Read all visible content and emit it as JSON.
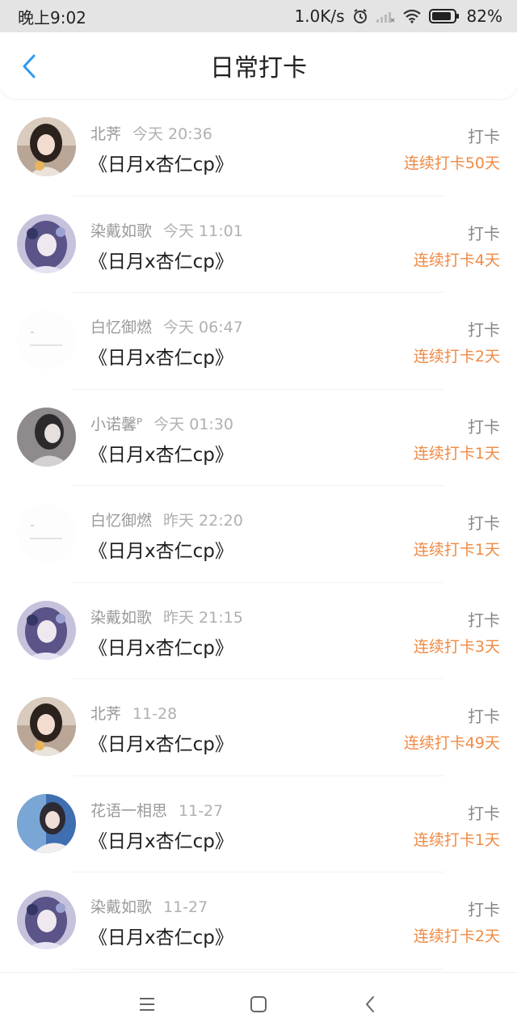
{
  "status_bar": {
    "time": "晚上9:02",
    "net_speed": "1.0K/s",
    "battery": "82%",
    "icons": [
      "alarm-icon",
      "signal-icon",
      "wifi-icon",
      "battery-icon"
    ]
  },
  "header": {
    "title": "日常打卡",
    "back_icon": "chevron-left-icon"
  },
  "colors": {
    "accent": "#2d9bf0",
    "streak": "#f08a44"
  },
  "records": [
    {
      "user": "北荠",
      "time": "今天 20:36",
      "title": "《日月x杏仁cp》",
      "action": "打卡",
      "streak": "连续打卡50天",
      "avatar": "photo-girl-dark"
    },
    {
      "user": "染戴如歌",
      "time": "今天 11:01",
      "title": "《日月x杏仁cp》",
      "action": "打卡",
      "streak": "连续打卡4天",
      "avatar": "anime-purple"
    },
    {
      "user": "白忆御燃",
      "time": "今天 06:47",
      "title": "《日月x杏仁cp》",
      "action": "打卡",
      "streak": "连续打卡2天",
      "avatar": "blank-white"
    },
    {
      "user": "小诺馨ᴾ",
      "time": "今天 01:30",
      "title": "《日月x杏仁cp》",
      "action": "打卡",
      "streak": "连续打卡1天",
      "avatar": "photo-grey"
    },
    {
      "user": "白忆御燃",
      "time": "昨天 22:20",
      "title": "《日月x杏仁cp》",
      "action": "打卡",
      "streak": "连续打卡1天",
      "avatar": "blank-white"
    },
    {
      "user": "染戴如歌",
      "time": "昨天 21:15",
      "title": "《日月x杏仁cp》",
      "action": "打卡",
      "streak": "连续打卡3天",
      "avatar": "anime-purple"
    },
    {
      "user": "北荠",
      "time": "11-28",
      "title": "《日月x杏仁cp》",
      "action": "打卡",
      "streak": "连续打卡49天",
      "avatar": "photo-girl-dark"
    },
    {
      "user": "花语一相思",
      "time": "11-27",
      "title": "《日月x杏仁cp》",
      "action": "打卡",
      "streak": "连续打卡1天",
      "avatar": "photo-blue"
    },
    {
      "user": "染戴如歌",
      "time": "11-27",
      "title": "《日月x杏仁cp》",
      "action": "打卡",
      "streak": "连续打卡2天",
      "avatar": "anime-purple"
    }
  ],
  "bottom_nav": [
    "menu-icon",
    "home-icon",
    "back-icon"
  ]
}
